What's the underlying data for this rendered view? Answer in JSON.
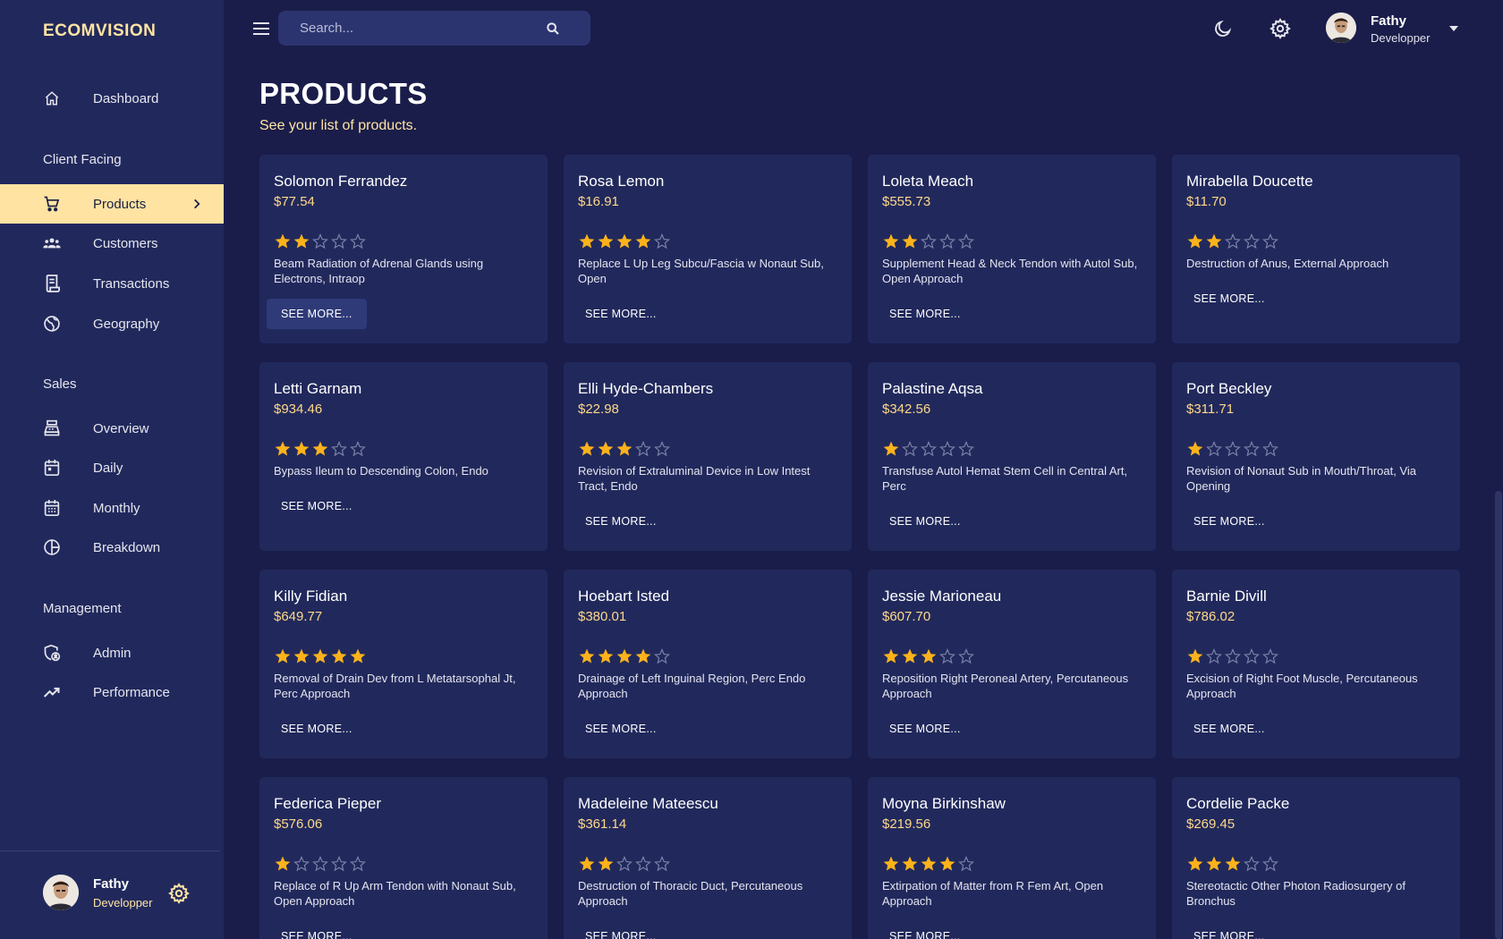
{
  "app": {
    "brand": "ECOMVISION",
    "accent": "#ffe3a3",
    "background": "#1a1d4a",
    "panel": "#21295c"
  },
  "sidebar": {
    "dashboard": {
      "label": "Dashboard",
      "icon": "home-icon"
    },
    "sections": {
      "client": "Client Facing",
      "sales": "Sales",
      "management": "Management"
    },
    "items": {
      "products": {
        "label": "Products",
        "icon": "cart-icon",
        "active": true
      },
      "customers": {
        "label": "Customers",
        "icon": "people-icon"
      },
      "transactions": {
        "label": "Transactions",
        "icon": "receipt-icon"
      },
      "geography": {
        "label": "Geography",
        "icon": "globe-icon"
      },
      "overview": {
        "label": "Overview",
        "icon": "point-of-sale-icon"
      },
      "daily": {
        "label": "Daily",
        "icon": "calendar-today-icon"
      },
      "monthly": {
        "label": "Monthly",
        "icon": "calendar-month-icon"
      },
      "breakdown": {
        "label": "Breakdown",
        "icon": "pie-chart-icon"
      },
      "admin": {
        "label": "Admin",
        "icon": "admin-icon"
      },
      "performance": {
        "label": "Performance",
        "icon": "trending-up-icon"
      }
    },
    "user": {
      "name": "Fathy",
      "role": "Developper"
    }
  },
  "topbar": {
    "search_placeholder": "Search...",
    "user": {
      "name": "Fathy",
      "role": "Developper"
    }
  },
  "page": {
    "title": "PRODUCTS",
    "subtitle": "See your list of products."
  },
  "products": [
    {
      "name": "Solomon Ferrandez",
      "price": "$77.54",
      "rating": 2,
      "description": "Beam Radiation of Adrenal Glands using Electrons, Intraop",
      "button": "SEE MORE..."
    },
    {
      "name": "Rosa Lemon",
      "price": "$16.91",
      "rating": 4,
      "description": "Replace L Up Leg Subcu/Fascia w Nonaut Sub, Open",
      "button": "SEE MORE..."
    },
    {
      "name": "Loleta Meach",
      "price": "$555.73",
      "rating": 2,
      "description": "Supplement Head & Neck Tendon with Autol Sub, Open Approach",
      "button": "SEE MORE..."
    },
    {
      "name": "Mirabella Doucette",
      "price": "$11.70",
      "rating": 2,
      "description": "Destruction of Anus, External Approach",
      "button": "SEE MORE..."
    },
    {
      "name": "Letti Garnam",
      "price": "$934.46",
      "rating": 3,
      "description": "Bypass Ileum to Descending Colon, Endo",
      "button": "SEE MORE..."
    },
    {
      "name": "Elli Hyde-Chambers",
      "price": "$22.98",
      "rating": 3,
      "description": "Revision of Extraluminal Device in Low Intest Tract, Endo",
      "button": "SEE MORE..."
    },
    {
      "name": "Palastine Aqsa",
      "price": "$342.56",
      "rating": 1,
      "description": "Transfuse Autol Hemat Stem Cell in Central Art, Perc",
      "button": "SEE MORE..."
    },
    {
      "name": "Port Beckley",
      "price": "$311.71",
      "rating": 1,
      "description": "Revision of Nonaut Sub in Mouth/Throat, Via Opening",
      "button": "SEE MORE..."
    },
    {
      "name": "Killy Fidian",
      "price": "$649.77",
      "rating": 5,
      "description": "Removal of Drain Dev from L Metatarsophal Jt, Perc Approach",
      "button": "SEE MORE..."
    },
    {
      "name": "Hoebart Isted",
      "price": "$380.01",
      "rating": 4,
      "description": "Drainage of Left Inguinal Region, Perc Endo Approach",
      "button": "SEE MORE..."
    },
    {
      "name": "Jessie Marioneau",
      "price": "$607.70",
      "rating": 3,
      "description": "Reposition Right Peroneal Artery, Percutaneous Approach",
      "button": "SEE MORE..."
    },
    {
      "name": "Barnie Divill",
      "price": "$786.02",
      "rating": 1,
      "description": "Excision of Right Foot Muscle, Percutaneous Approach",
      "button": "SEE MORE..."
    },
    {
      "name": "Federica Pieper",
      "price": "$576.06",
      "rating": 1,
      "description": "Replace of R Up Arm Tendon with Nonaut Sub, Open Approach",
      "button": "SEE MORE..."
    },
    {
      "name": "Madeleine Mateescu",
      "price": "$361.14",
      "rating": 2,
      "description": "Destruction of Thoracic Duct, Percutaneous Approach",
      "button": "SEE MORE..."
    },
    {
      "name": "Moyna Birkinshaw",
      "price": "$219.56",
      "rating": 4,
      "description": "Extirpation of Matter from R Fem Art, Open Approach",
      "button": "SEE MORE..."
    },
    {
      "name": "Cordelie Packe",
      "price": "$269.45",
      "rating": 3,
      "description": "Stereotactic Other Photon Radiosurgery of Bronchus",
      "button": "SEE MORE..."
    }
  ]
}
